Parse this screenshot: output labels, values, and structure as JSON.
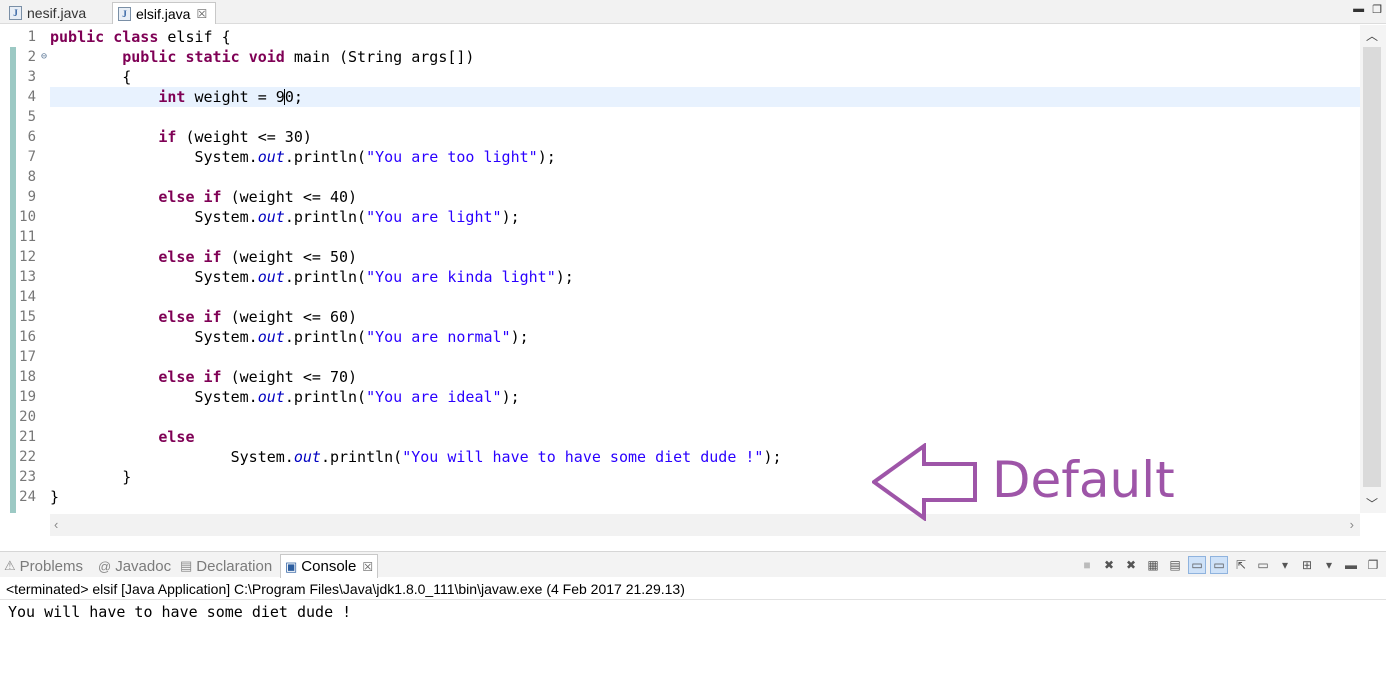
{
  "editor_tabs": [
    {
      "label": "nesif.java",
      "active": false
    },
    {
      "label": "elsif.java",
      "active": true
    }
  ],
  "close_glyph": "☒",
  "code_lines": [
    [
      {
        "t": "public",
        "c": "kw"
      },
      {
        "t": " "
      },
      {
        "t": "class",
        "c": "kw"
      },
      {
        "t": " elsif {"
      }
    ],
    [
      {
        "t": "        "
      },
      {
        "t": "public",
        "c": "kw"
      },
      {
        "t": " "
      },
      {
        "t": "static",
        "c": "kw"
      },
      {
        "t": " "
      },
      {
        "t": "void",
        "c": "kw"
      },
      {
        "t": " main (String args[])"
      }
    ],
    [
      {
        "t": "        {"
      }
    ],
    [
      {
        "t": "            "
      },
      {
        "t": "int",
        "c": "kw"
      },
      {
        "t": " weight = 9"
      },
      {
        "caret": true
      },
      {
        "t": "0;"
      }
    ],
    [],
    [
      {
        "t": "            "
      },
      {
        "t": "if",
        "c": "kw"
      },
      {
        "t": " (weight <= 30)"
      }
    ],
    [
      {
        "t": "                System."
      },
      {
        "t": "out",
        "c": "fld"
      },
      {
        "t": ".println("
      },
      {
        "t": "\"You are too light\"",
        "c": "str"
      },
      {
        "t": ");"
      }
    ],
    [],
    [
      {
        "t": "            "
      },
      {
        "t": "else",
        "c": "kw"
      },
      {
        "t": " "
      },
      {
        "t": "if",
        "c": "kw"
      },
      {
        "t": " (weight <= 40)"
      }
    ],
    [
      {
        "t": "                System."
      },
      {
        "t": "out",
        "c": "fld"
      },
      {
        "t": ".println("
      },
      {
        "t": "\"You are light\"",
        "c": "str"
      },
      {
        "t": ");"
      }
    ],
    [],
    [
      {
        "t": "            "
      },
      {
        "t": "else",
        "c": "kw"
      },
      {
        "t": " "
      },
      {
        "t": "if",
        "c": "kw"
      },
      {
        "t": " (weight <= 50)"
      }
    ],
    [
      {
        "t": "                System."
      },
      {
        "t": "out",
        "c": "fld"
      },
      {
        "t": ".println("
      },
      {
        "t": "\"You are kinda light\"",
        "c": "str"
      },
      {
        "t": ");"
      }
    ],
    [],
    [
      {
        "t": "            "
      },
      {
        "t": "else",
        "c": "kw"
      },
      {
        "t": " "
      },
      {
        "t": "if",
        "c": "kw"
      },
      {
        "t": " (weight <= 60)"
      }
    ],
    [
      {
        "t": "                System."
      },
      {
        "t": "out",
        "c": "fld"
      },
      {
        "t": ".println("
      },
      {
        "t": "\"You are normal\"",
        "c": "str"
      },
      {
        "t": ");"
      }
    ],
    [],
    [
      {
        "t": "            "
      },
      {
        "t": "else",
        "c": "kw"
      },
      {
        "t": " "
      },
      {
        "t": "if",
        "c": "kw"
      },
      {
        "t": " (weight <= 70)"
      }
    ],
    [
      {
        "t": "                System."
      },
      {
        "t": "out",
        "c": "fld"
      },
      {
        "t": ".println("
      },
      {
        "t": "\"You are ideal\"",
        "c": "str"
      },
      {
        "t": ");"
      }
    ],
    [],
    [
      {
        "t": "            "
      },
      {
        "t": "else",
        "c": "kw"
      }
    ],
    [
      {
        "t": "                    System."
      },
      {
        "t": "out",
        "c": "fld"
      },
      {
        "t": ".println("
      },
      {
        "t": "\"You will have to have some diet dude !\"",
        "c": "str"
      },
      {
        "t": ");"
      }
    ],
    [
      {
        "t": "        }"
      }
    ],
    [
      {
        "t": "}"
      }
    ]
  ],
  "line_numbers": [
    "1",
    "2",
    "3",
    "4",
    "5",
    "6",
    "7",
    "8",
    "9",
    "10",
    "11",
    "12",
    "13",
    "14",
    "15",
    "16",
    "17",
    "18",
    "19",
    "20",
    "21",
    "22",
    "23",
    "24"
  ],
  "current_line": 4,
  "fold_line": 2,
  "annotation": {
    "label": "Default",
    "color": "#9e55a8"
  },
  "view_tabs": [
    {
      "label": "Problems",
      "icon": "problems-icon",
      "active": false
    },
    {
      "label": "Javadoc",
      "icon": "javadoc-icon",
      "active": false
    },
    {
      "label": "Declaration",
      "icon": "declaration-icon",
      "active": false
    },
    {
      "label": "Console",
      "icon": "console-icon",
      "active": true
    }
  ],
  "console": {
    "header": "<terminated> elsif [Java Application] C:\\Program Files\\Java\\jdk1.8.0_111\\bin\\javaw.exe (4 Feb 2017 21.29.13)",
    "output": "You will have to have some diet dude !"
  },
  "colors": {
    "keyword": "#7f0055",
    "string": "#2a00ff",
    "field": "#0000c0",
    "current_line": "#e8f2fe"
  }
}
